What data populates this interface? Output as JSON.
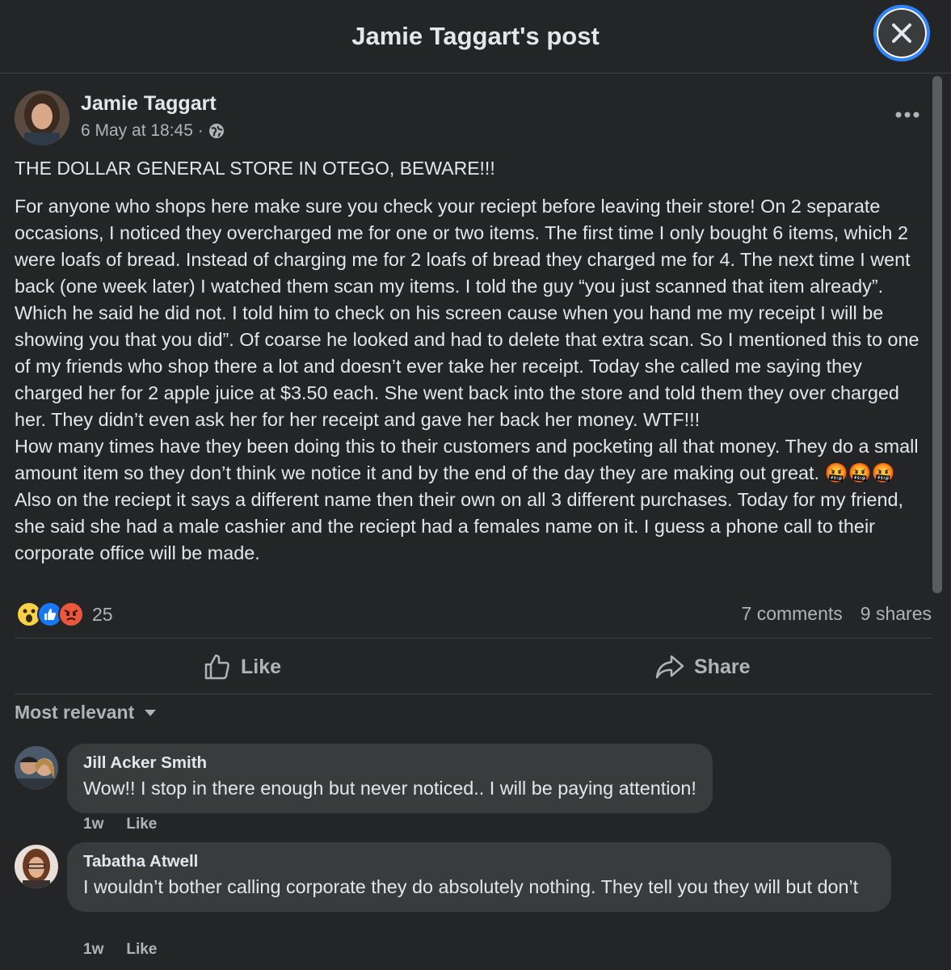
{
  "header": {
    "title": "Jamie Taggart's post"
  },
  "post": {
    "author": "Jamie Taggart",
    "time": "6 May at 18:45 ·",
    "headline": "THE DOLLAR GENERAL STORE IN OTEGO, BEWARE!!!",
    "body": "For anyone who shops here make sure you check your reciept before leaving their store! On 2 separate occasions, I noticed they overcharged me for one or two items. The first time I only bought 6 items, which 2 were loafs of bread. Instead of charging me for 2 loafs of bread they charged me for 4. The next time I went back (one week later) I watched them scan my items. I told the guy “you just scanned that item already”. Which he said he did not. I told him to check on his screen cause when you hand me my receipt I will be showing you that you did”. Of coarse he looked and had to delete that extra scan. So I mentioned this to one of my friends who shop there a lot and doesn’t ever take her receipt. Today she called me saying they charged her for 2 apple juice at $3.50 each. She went back into the store and told them they over charged her. They didn’t even ask her for her receipt and gave her back her money. WTF!!!\nHow many times have they been doing this to their customers and pocketing all that money. They do a small amount item so they don’t think we notice it and by the end of the day they are making out great. 🤬🤬🤬  Also on the reciept it says a different name then their own on all 3 different purchases. Today for my friend, she said she had a male cashier and the reciept had a females name on it. I guess a phone call to their corporate office will be made.",
    "reaction_count": "25",
    "comments_count": "7 comments",
    "shares_count": "9 shares"
  },
  "actions": {
    "like": "Like",
    "share": "Share"
  },
  "sort_label": "Most relevant",
  "comments": [
    {
      "name": "Jill Acker Smith",
      "text": "Wow!! I stop in there enough but never noticed.. I will be paying attention!",
      "age": "1w",
      "like": "Like"
    },
    {
      "name": "Tabatha Atwell",
      "text": "I wouldn’t bother calling corporate they do absolutely nothing. They tell you they will but don’t",
      "age": "1w",
      "like": "Like"
    }
  ],
  "colors": {
    "background": "#242526",
    "bubble": "#3a3b3c",
    "text": "#e4e6eb",
    "muted": "#b0b3b8",
    "accent": "#2d86ff"
  },
  "icons": [
    "close-icon",
    "more-icon",
    "globe-icon",
    "wow-reaction-icon",
    "like-reaction-icon",
    "angry-reaction-icon",
    "thumbs-up-icon",
    "share-arrow-icon",
    "caret-down-icon"
  ]
}
